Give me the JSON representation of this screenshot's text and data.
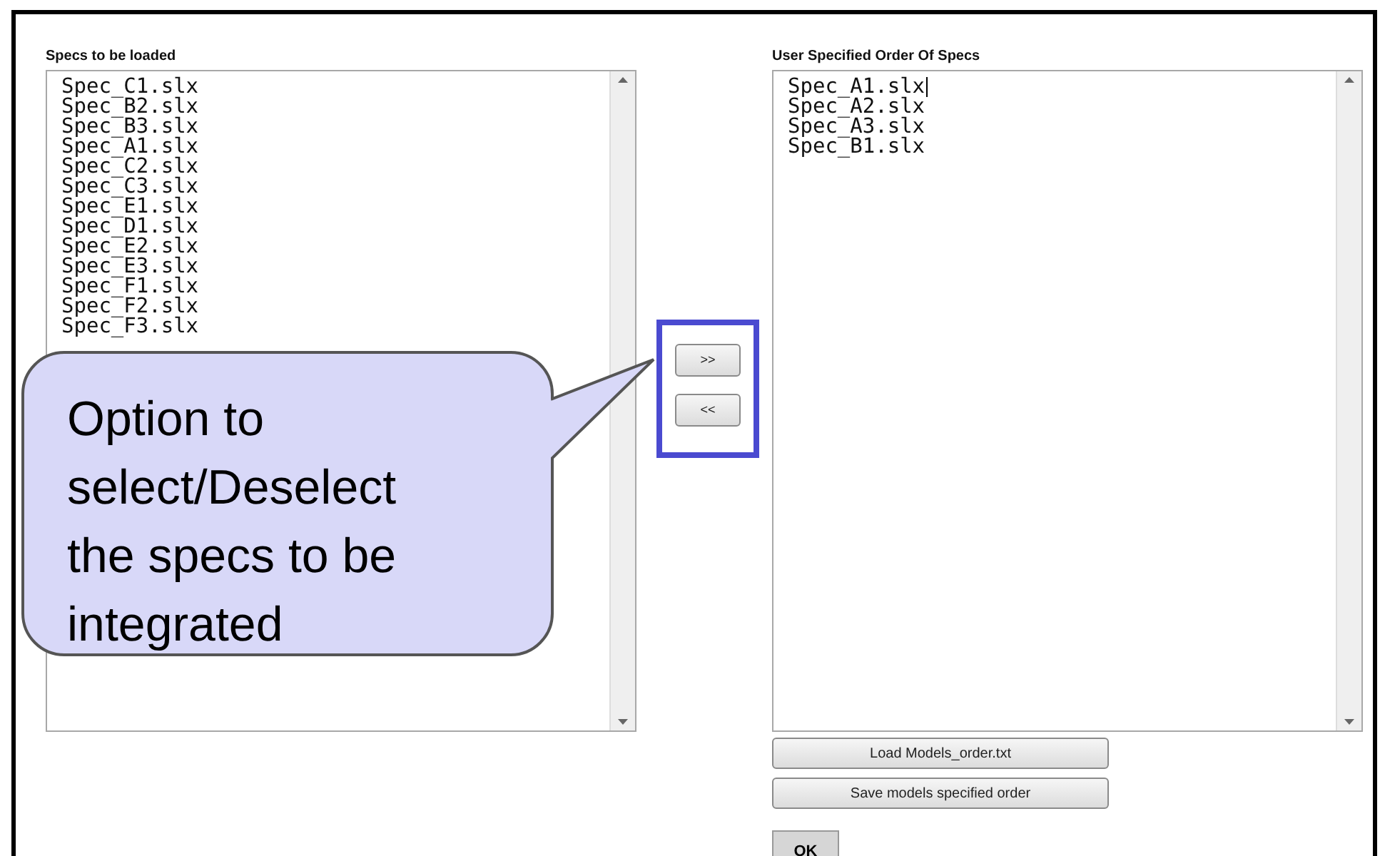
{
  "left_list": {
    "label": "Specs to be loaded",
    "items": [
      "Spec_C1.slx",
      "Spec_B2.slx",
      "Spec_B3.slx",
      "Spec_A1.slx",
      "Spec_C2.slx",
      "Spec_C3.slx",
      "Spec_E1.slx",
      "Spec_D1.slx",
      "Spec_E2.slx",
      "Spec_E3.slx",
      "Spec_F1.slx",
      "Spec_F2.slx",
      "Spec_F3.slx"
    ]
  },
  "move_buttons": [
    ">>",
    "<<"
  ],
  "right_list": {
    "label": "User Specified Order Of Specs",
    "items": [
      {
        "text": "Spec_A1.slx",
        "caret": true
      },
      {
        "text": "Spec_A2.slx",
        "caret": false
      },
      {
        "text": "Spec_A3.slx",
        "caret": false
      },
      {
        "text": "Spec_B1.slx",
        "caret": false
      }
    ]
  },
  "action_buttons": [
    "Load Models_order.txt",
    "Save models specified order"
  ],
  "ok_button": "OK",
  "callout": {
    "text": "Option to select/Deselect the specs to be integrated"
  }
}
